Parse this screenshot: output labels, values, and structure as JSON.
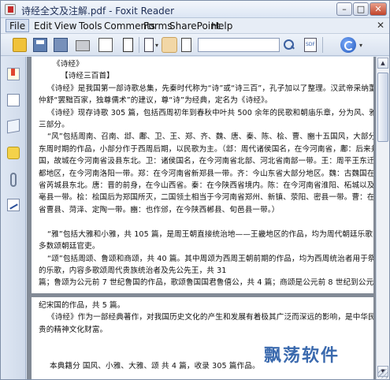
{
  "window": {
    "title": "诗经全文及注解.pdf - Foxit Reader",
    "minimize_glyph": "–",
    "maximize_glyph": "□",
    "close_glyph": "✕"
  },
  "menubar": {
    "items": [
      "File",
      "Edit",
      "View",
      "Tools",
      "Comments",
      "Forms",
      "SharePoint",
      "Help"
    ],
    "close_glyph": "✕"
  },
  "toolbar": {
    "search_value": "",
    "icons": [
      "open-icon",
      "save-icon",
      "save-as-icon",
      "print-icon",
      "properties-icon",
      "text-icon",
      "page-layout-icon",
      "hand-tool-icon",
      "select-text-icon",
      "search-icon",
      "sdf-icon",
      "snapshot-icon",
      "update-icon"
    ],
    "sdf_label": "SDF",
    "dropdown_glyph": "▾"
  },
  "sidebar": {
    "icons": [
      "bookmarks-icon",
      "pages-icon",
      "layers-icon",
      "comments-icon",
      "attachments-icon",
      "signatures-icon"
    ]
  },
  "document": {
    "page1_lines": [
      "《诗经》",
      "【诗经三百首】",
      "《诗经》是我国第一部诗歌总集，先秦时代称为“诗”或“诗三百”，孔子加以了整理。汉武帝采纳董",
      "仲舒“罢黜百家，独尊儒术”的建议，尊“诗”为经典，定名为《诗经》。",
      "《诗经》现存诗歌 305 篇，包括西周初年到春秋中叶共 500 余年的民歌和朝庙乐章，分为风、雅、颂",
      "三部分。",
      "“风”包括周南、召南、邶、鄘、卫、王、郑、齐、魏、唐、秦、陈、桧、曹、豳十五国风，大部分为",
      "东周时期的作品，小部分作于西周后期，以民歌为主。（邶：周代诸侯国名，在今河南省，鄘：后来并入卫",
      "国，故城在今河南省汲县东北。卫：诸侯国名，在今河南省北部、河北省南部一带。王：周平王东迁后的国",
      "都地区，在今河南洛阳一带。郑：在今河南省新郑县一带。齐：今山东省大部分地区。魏：古魏国在今山西",
      "省芮城县东北。唐：晋的前身，在今山西省。秦：在今陕西省境内。陈：在今河南省淮阳、柘城以及安徽省",
      "亳县一带。桧：桧国后为郑国所灭，二国领土相当于今河南省郑州、新镇、荥阳、密县一带。曹：在今山东",
      "省曹县、菏泽、定陶一带。豳：也作邠，在今陕西郴县、旬邑县一带。）",
      "",
      "“雅”包括大雅和小雅，共 105 篇，是周王朝直接统治地——王畿地区的作品，均为周代朝廷乐歌，",
      "多数颂朝廷官吏。",
      "“颂”包括周颂、鲁颂和商颂，共 40 篇。其中周颂为西周王朝前期的作品，均为西周统治者用于祭祀",
      "的乐歌，内容多歌颂周代贵族统治者及先公先王，共 31",
      "篇；鲁颂为公元前 7 世纪鲁国的作品，歌颂鲁国国君鲁僖公，共 4 篇；商颂是公元前 8 世纪到公元前 7 世"
    ],
    "page2_lines": [
      "纪宋国的作品，共 5 篇。",
      "《诗经》作为一部经典著作，对我国历史文化的产生和发展有着极其广泛而深远的影响，是中华民族宝",
      "贵的精神文化财富。",
      "",
      "",
      "本典籍分 国风、小雅、大雅、颂 共 4 篇，收录 305 篇作品。"
    ]
  },
  "scrollbar": {
    "up_glyph": "▲",
    "down_glyph": "▼"
  },
  "watermark": {
    "text": "飘荡软件"
  }
}
